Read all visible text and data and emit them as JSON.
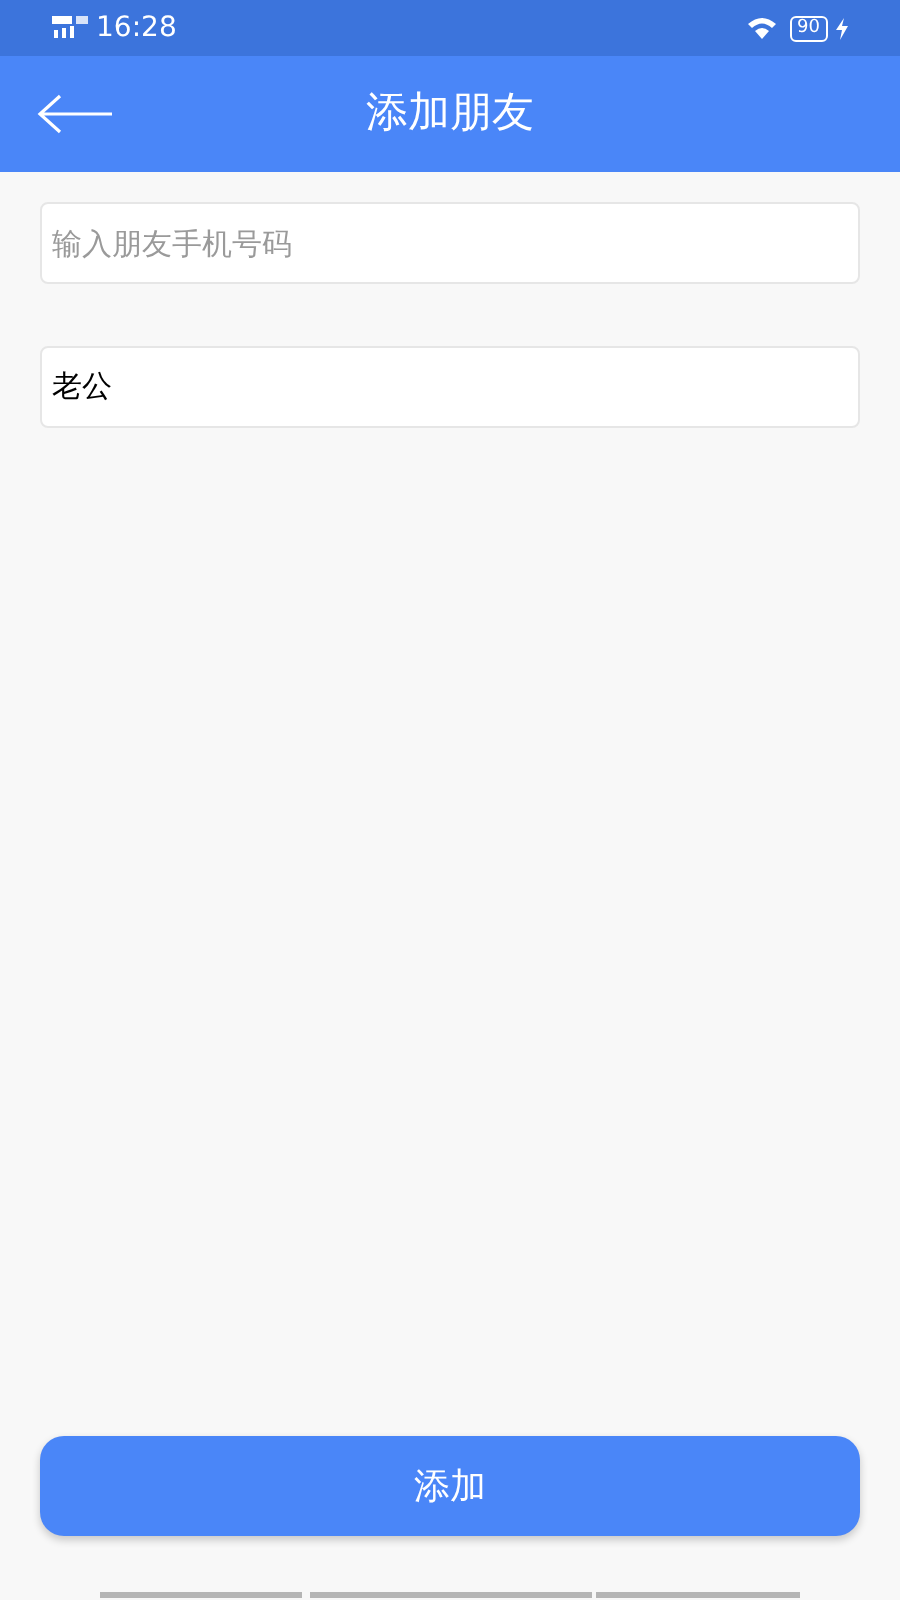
{
  "status_bar": {
    "time": "16:28",
    "battery": "90"
  },
  "header": {
    "title": "添加朋友"
  },
  "fields": [
    {
      "placeholder": "输入朋友手机号码"
    },
    {
      "value": "老公"
    }
  ],
  "submit_button": {
    "label": "添加"
  }
}
